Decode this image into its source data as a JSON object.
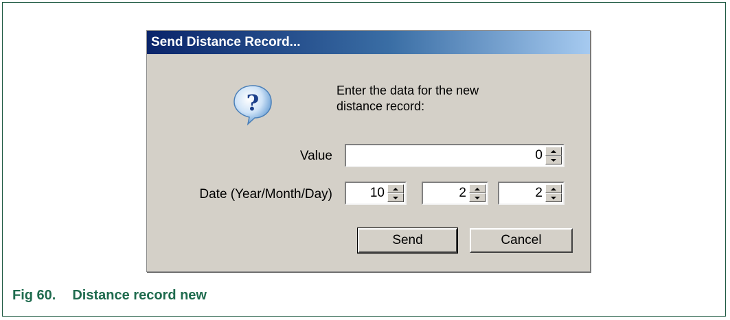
{
  "dialog": {
    "title": "Send Distance Record...",
    "prompt": "Enter the data for the new distance record:",
    "value_label": "Value",
    "value": "0",
    "date_label": "Date (Year/Month/Day)",
    "date_year": "10",
    "date_month": "2",
    "date_day": "2",
    "send_label": "Send",
    "cancel_label": "Cancel",
    "icon": "question-icon"
  },
  "caption": {
    "number": "Fig 60.",
    "text": "Distance record new",
    "color": "#1f6b4e"
  }
}
